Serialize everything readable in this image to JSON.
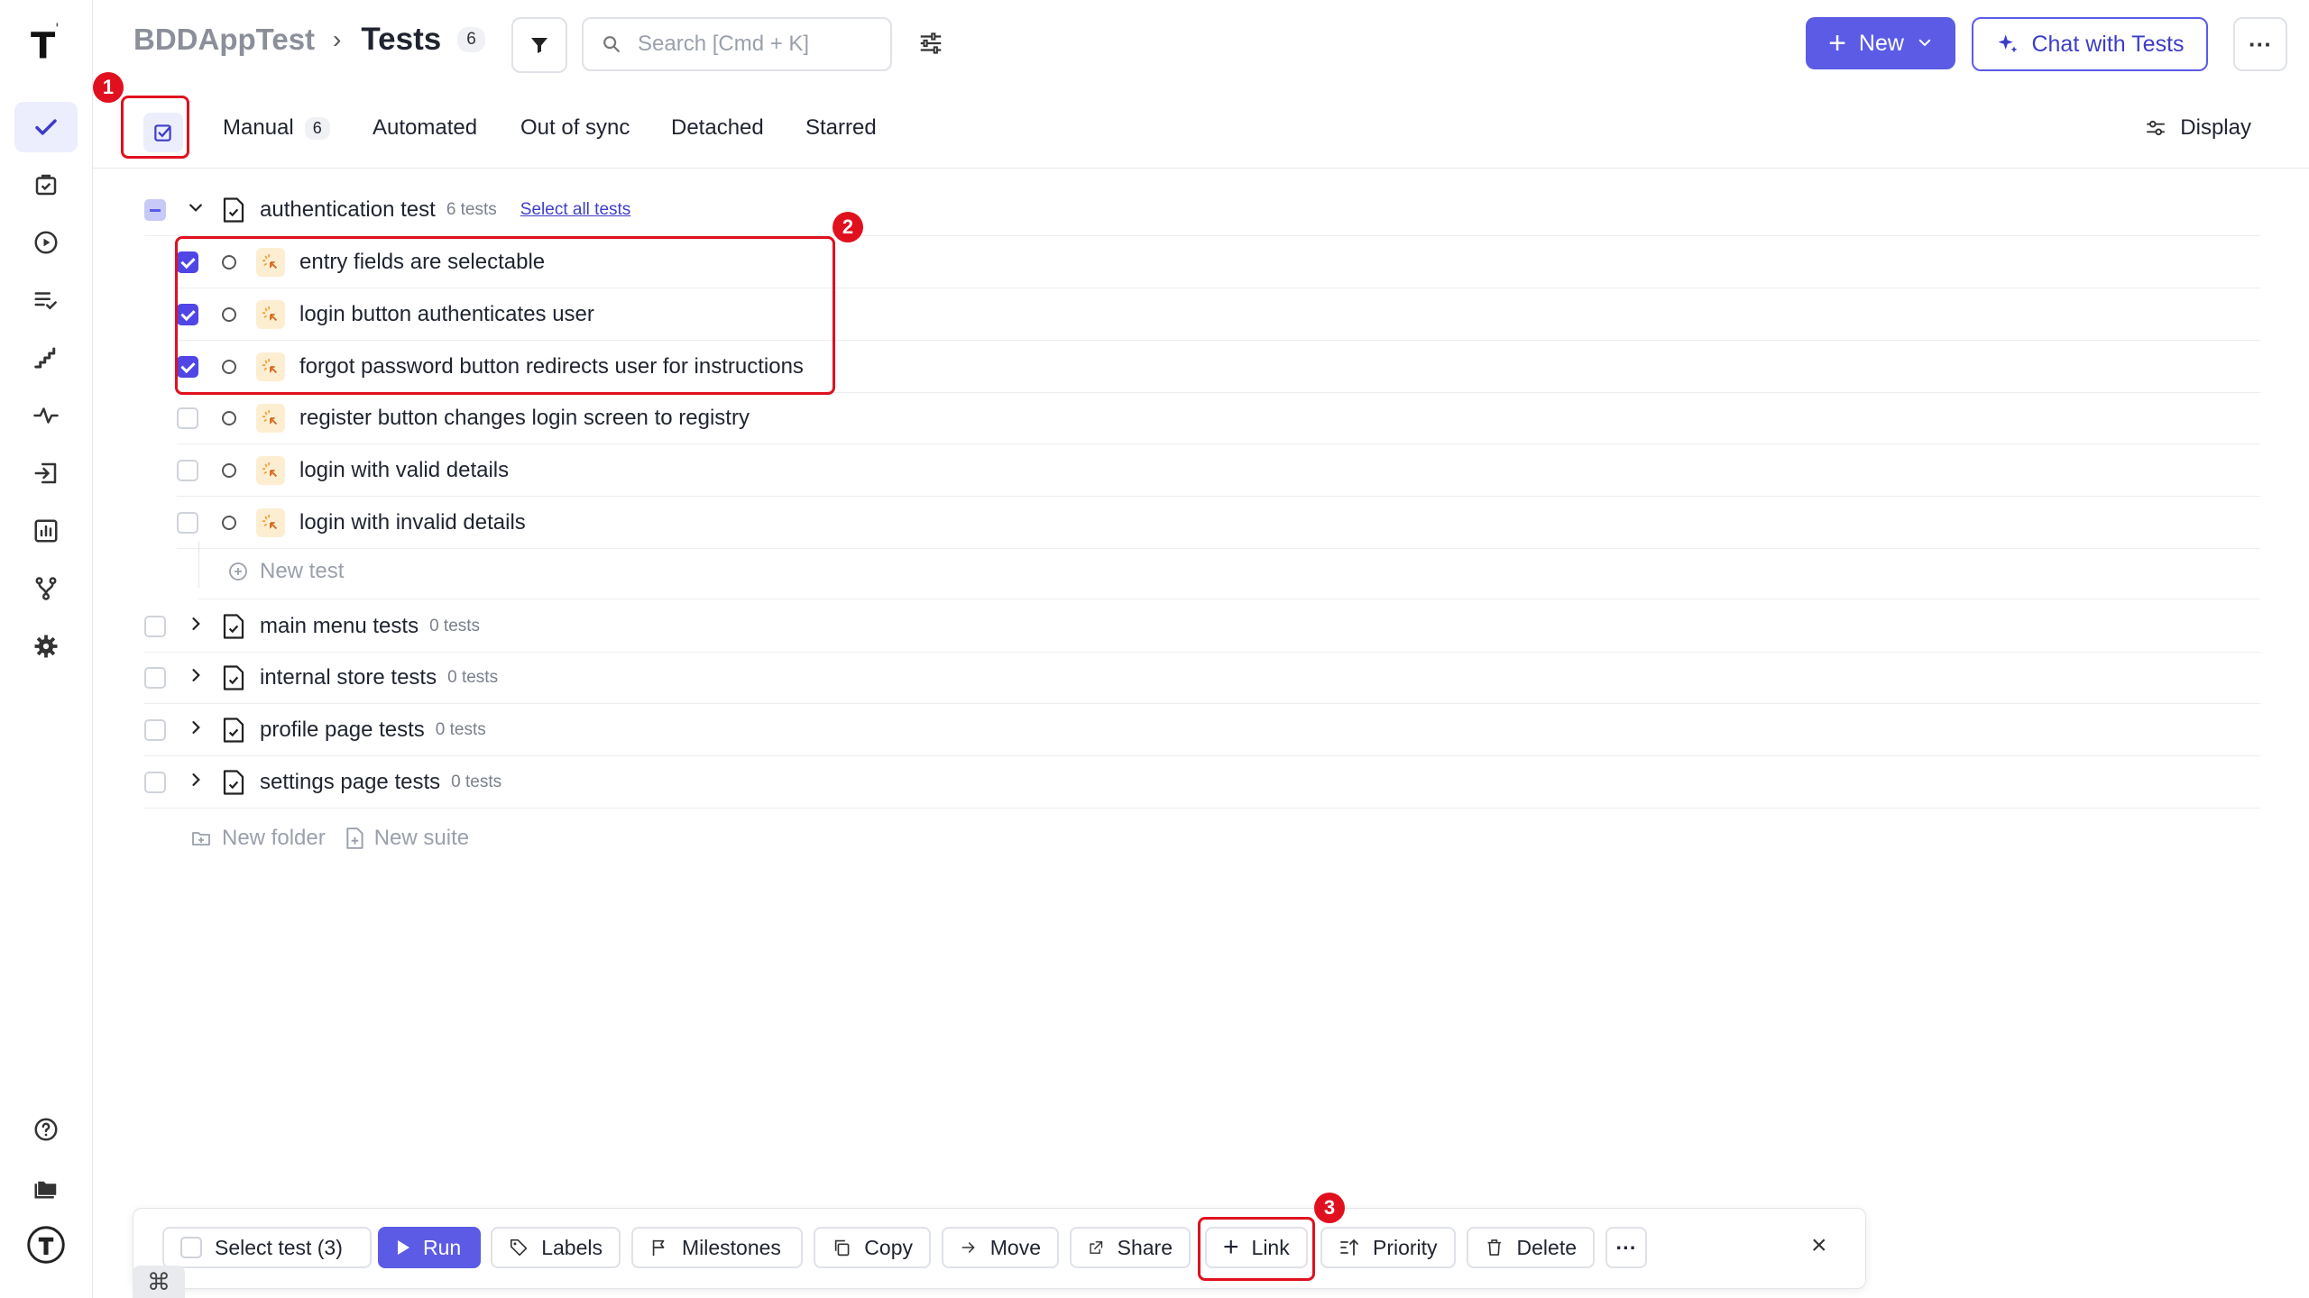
{
  "header": {
    "project": "BDDAppTest",
    "separator": "›",
    "title": "Tests",
    "count": "6",
    "search_placeholder": "Search [Cmd + K]",
    "new_label": "New",
    "chat_label": "Chat with Tests",
    "more_label": "···"
  },
  "tabs": [
    {
      "label": "Manual",
      "badge": "6"
    },
    {
      "label": "Automated"
    },
    {
      "label": "Out of sync"
    },
    {
      "label": "Detached"
    },
    {
      "label": "Starred"
    }
  ],
  "display_label": "Display",
  "suites": [
    {
      "name": "authentication test",
      "count": "6 tests",
      "select_all": "Select all tests",
      "expanded": true
    },
    {
      "name": "main menu tests",
      "count": "0 tests"
    },
    {
      "name": "internal store tests",
      "count": "0 tests"
    },
    {
      "name": "profile page tests",
      "count": "0 tests"
    },
    {
      "name": "settings page tests",
      "count": "0 tests"
    }
  ],
  "tests": [
    {
      "name": "entry fields are selectable",
      "checked": true
    },
    {
      "name": "login button authenticates user",
      "checked": true
    },
    {
      "name": "forgot password button redirects user for instructions",
      "checked": true
    },
    {
      "name": "register button changes login screen to registry",
      "checked": false
    },
    {
      "name": "login with valid details",
      "checked": false
    },
    {
      "name": "login with invalid details",
      "checked": false
    }
  ],
  "new_test_label": "New test",
  "new_folder_label": "New folder",
  "new_suite_label": "New suite",
  "bulk": {
    "select": "Select test (3)",
    "run": "Run",
    "labels": "Labels",
    "milestones": "Milestones",
    "copy": "Copy",
    "move": "Move",
    "share": "Share",
    "link": "Link",
    "priority": "Priority",
    "delete": "Delete",
    "more": "···",
    "close": "×",
    "cmd": "⌘"
  },
  "annotations": [
    "1",
    "2",
    "3"
  ],
  "colors": {
    "accent": "#5b5be6",
    "annotation": "#e0101f"
  }
}
